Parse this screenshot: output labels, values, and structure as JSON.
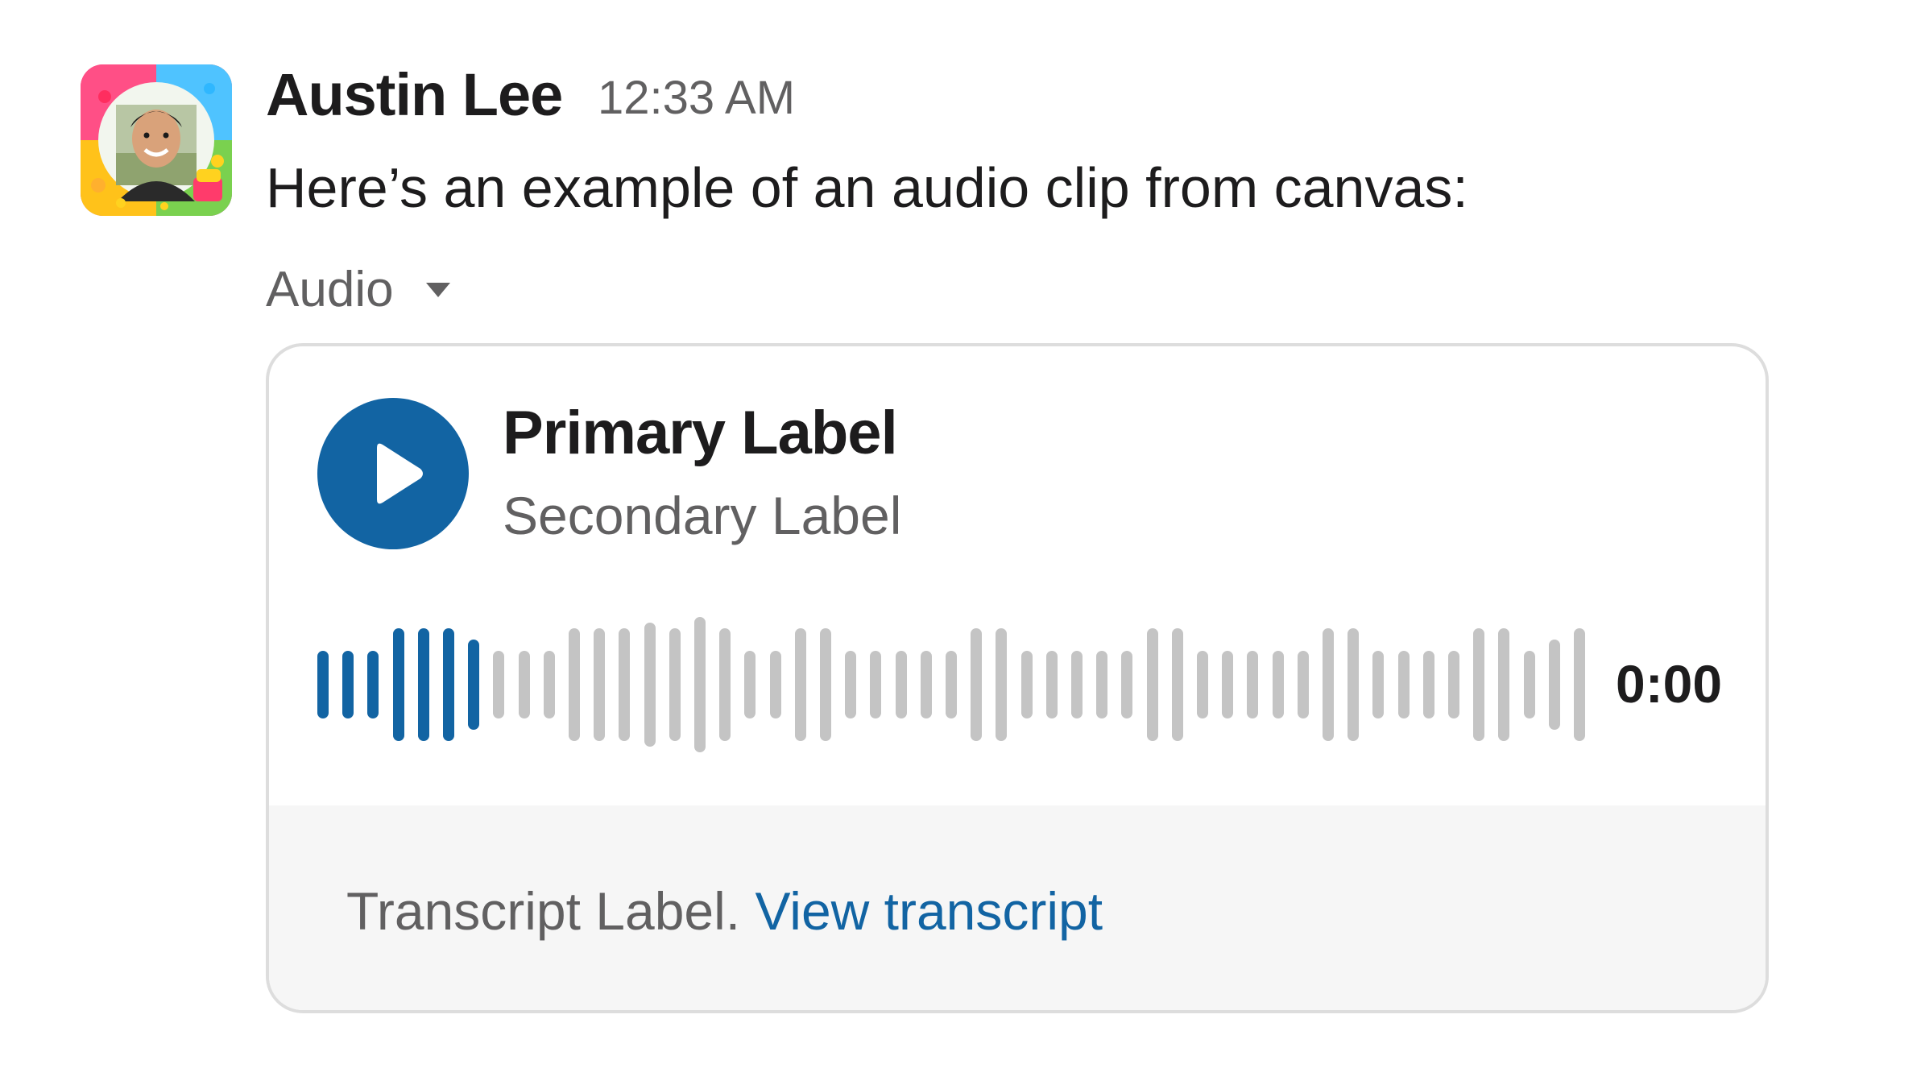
{
  "message": {
    "sender": "Austin Lee",
    "timestamp": "12:33 AM",
    "text": "Here’s an example of an audio clip from canvas:",
    "avatar_icon": "profile-photo",
    "attachment_section": {
      "label": "Audio",
      "toggle_icon": "caret-down-icon"
    }
  },
  "audio_player": {
    "primary_label": "Primary Label",
    "secondary_label": "Secondary Label",
    "duration": "0:00",
    "play_icon": "play-icon",
    "waveform": {
      "played_bars": 7,
      "levels": [
        0.6,
        0.6,
        0.6,
        1.0,
        1.0,
        1.0,
        0.8,
        0.6,
        0.6,
        0.6,
        1.0,
        1.0,
        1.0,
        1.1,
        1.0,
        1.2,
        1.0,
        0.6,
        0.6,
        1.0,
        1.0,
        0.6,
        0.6,
        0.6,
        0.6,
        0.6,
        1.0,
        1.0,
        0.6,
        0.6,
        0.6,
        0.6,
        0.6,
        1.0,
        1.0,
        0.6,
        0.6,
        0.6,
        0.6,
        0.6,
        1.0,
        1.0,
        0.6,
        0.6,
        0.6,
        0.6,
        1.0,
        1.0,
        0.6,
        0.8,
        1.0
      ],
      "played_color": "#1264a3",
      "unplayed_color": "#c4c4c4"
    },
    "transcript": {
      "label": "Transcript Label.",
      "link": "View transcript"
    }
  },
  "colors": {
    "accent": "#1264a3",
    "text_primary": "#1d1c1d",
    "text_secondary": "#616061",
    "card_border": "#dddddd",
    "transcript_background": "#f6f6f6"
  }
}
